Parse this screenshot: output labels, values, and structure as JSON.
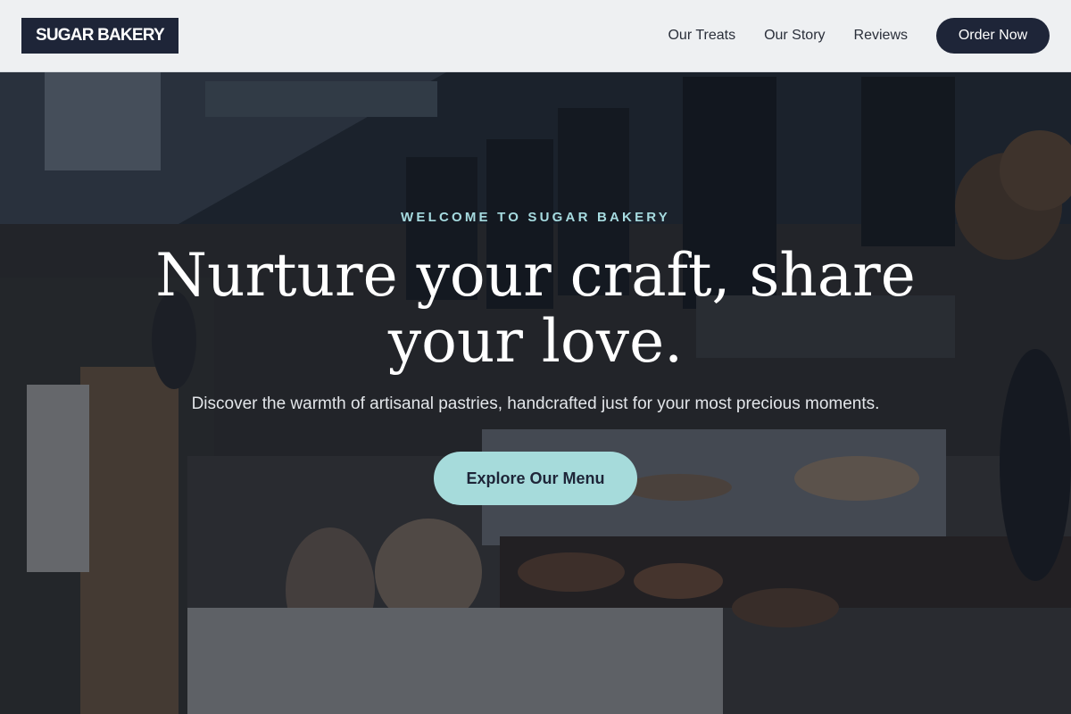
{
  "header": {
    "logo": "SUGAR BAKERY",
    "nav": [
      "Our Treats",
      "Our Story",
      "Reviews"
    ],
    "order_label": "Order Now"
  },
  "hero": {
    "eyebrow": "WELCOME TO SUGAR BAKERY",
    "headline": "Nurture your craft, share your love.",
    "subtext": "Discover the warmth of artisanal pastries, handcrafted just for your most precious moments.",
    "cta_label": "Explore Our Menu",
    "background_image": "bakery-interior-photo"
  },
  "colors": {
    "navy": "#1e2538",
    "accent": "#a6dbdb",
    "header_bg": "#eef0f2"
  }
}
